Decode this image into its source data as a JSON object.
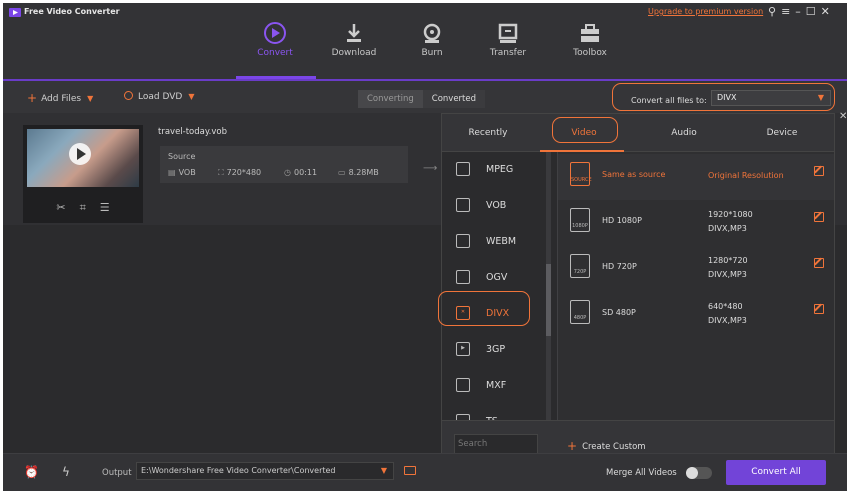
{
  "app": {
    "title": "Free Video Converter",
    "upgrade_link": "Upgrade to premium version"
  },
  "nav": {
    "items": [
      {
        "label": "Convert",
        "icon": "convert-icon",
        "active": true
      },
      {
        "label": "Download",
        "icon": "download-icon"
      },
      {
        "label": "Burn",
        "icon": "burn-icon"
      },
      {
        "label": "Transfer",
        "icon": "transfer-icon"
      },
      {
        "label": "Toolbox",
        "icon": "toolbox-icon"
      }
    ]
  },
  "toolbar": {
    "add_files": "Add Files",
    "load_dvd": "Load DVD",
    "converting": "Converting",
    "converted": "Converted",
    "convert_all_label": "Convert all files to:",
    "convert_all_value": "DIVX"
  },
  "file": {
    "name": "travel-today.vob",
    "source_label": "Source",
    "format": "VOB",
    "resolution": "720*480",
    "duration": "00:11",
    "size": "8.28MB"
  },
  "popup": {
    "tabs": [
      "Recently",
      "Video",
      "Audio",
      "Device"
    ],
    "active_tab": "Video",
    "formats": [
      "MPEG",
      "VOB",
      "WEBM",
      "OGV",
      "DIVX",
      "3GP",
      "MXF",
      "TS"
    ],
    "active_format": "DIVX",
    "resolutions": [
      {
        "name": "Same as source",
        "res": "Original Resolution",
        "codec": "",
        "badge": "SOURCE"
      },
      {
        "name": "HD 1080P",
        "res": "1920*1080",
        "codec": "DIVX,MP3",
        "badge": "1080P"
      },
      {
        "name": "HD 720P",
        "res": "1280*720",
        "codec": "DIVX,MP3",
        "badge": "720P"
      },
      {
        "name": "SD 480P",
        "res": "640*480",
        "codec": "DIVX,MP3",
        "badge": "480P"
      }
    ],
    "search_placeholder": "Search",
    "create_custom": "Create Custom"
  },
  "bottom": {
    "output_label": "Output",
    "output_path": "E:\\Wondershare Free Video Converter\\Converted",
    "merge_label": "Merge All Videos",
    "convert_all_button": "Convert All"
  },
  "colors": {
    "accent": "#f0743a",
    "brand": "#7244d8"
  }
}
